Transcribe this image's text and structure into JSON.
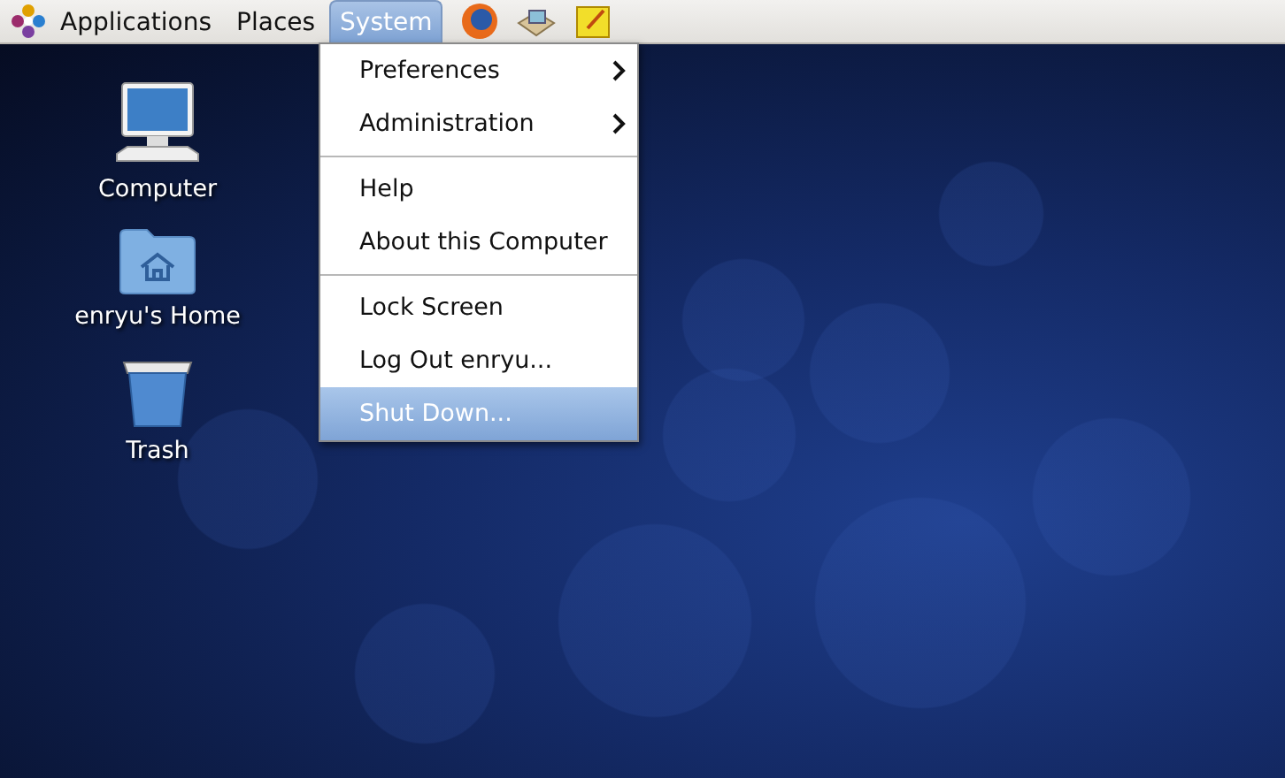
{
  "panel": {
    "menus": [
      {
        "label": "Applications",
        "selected": false
      },
      {
        "label": "Places",
        "selected": false
      },
      {
        "label": "System",
        "selected": true
      }
    ]
  },
  "desktop": {
    "icons": [
      {
        "kind": "computer",
        "label": "Computer"
      },
      {
        "kind": "home",
        "label": "enryu's Home"
      },
      {
        "kind": "trash",
        "label": "Trash"
      }
    ]
  },
  "system_menu": {
    "sections": [
      [
        {
          "label": "Preferences",
          "submenu": true,
          "selected": false
        },
        {
          "label": "Administration",
          "submenu": true,
          "selected": false
        }
      ],
      [
        {
          "label": "Help",
          "submenu": false,
          "selected": false
        },
        {
          "label": "About this Computer",
          "submenu": false,
          "selected": false
        }
      ],
      [
        {
          "label": "Lock Screen",
          "submenu": false,
          "selected": false
        },
        {
          "label": "Log Out enryu...",
          "submenu": false,
          "selected": false
        },
        {
          "label": "Shut Down...",
          "submenu": false,
          "selected": true
        }
      ]
    ]
  }
}
